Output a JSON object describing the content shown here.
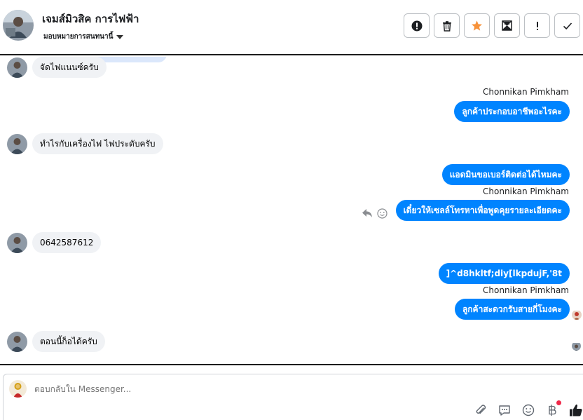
{
  "header": {
    "title": "เจมส์มิวสิค การไฟฟ้า",
    "subtitle": "มอบหมายการสนทนานี้",
    "actions": [
      {
        "name": "report-button",
        "icon": "alert-circle-icon"
      },
      {
        "name": "delete-button",
        "icon": "trash-icon"
      },
      {
        "name": "star-button",
        "icon": "star-icon"
      },
      {
        "name": "mark-unread-button",
        "icon": "envelope-icon"
      },
      {
        "name": "important-button",
        "icon": "exclamation-icon"
      },
      {
        "name": "done-button",
        "icon": "check-icon"
      }
    ]
  },
  "messages": [
    {
      "side": "in",
      "text": "จัดไฟแนนซ์ครับ"
    },
    {
      "side": "out",
      "sender": "Chonnikan Pimkham",
      "text": "ลูกค้าประกอบอาชีพอะไรคะ"
    },
    {
      "side": "in",
      "text": "ทำไรกับเครื่องไฟ ไฟประดับครับ"
    },
    {
      "side": "out",
      "text": "แอดมินขอเบอร์ติดต่อได้ไหมคะ"
    },
    {
      "side": "out",
      "sender": "Chonnikan Pimkham",
      "text": "เดี๋ยวให้เซลล์โทรหาเพื่อพูดคุยรายละเอียดคะ"
    },
    {
      "side": "in",
      "text": "0642587612"
    },
    {
      "side": "out",
      "text": "]^d8hkltf;diy[lkpdujF,'8t"
    },
    {
      "side": "out",
      "sender": "Chonnikan Pimkham",
      "text": "ลูกค้าสะดวกรับสายกี่โมงคะ"
    },
    {
      "side": "in",
      "text": "ตอนนี้ก็อได้ครับ"
    }
  ],
  "composer": {
    "placeholder": "ตอบกลับใน Messenger...",
    "tools": [
      "paperclip-icon",
      "saved-reply-icon",
      "emoji-icon",
      "baht-icon",
      "thumbs-up-icon"
    ]
  },
  "colors": {
    "outgoing": "#0084ff",
    "incoming": "#f0f2f5",
    "star": "#f7923a"
  }
}
